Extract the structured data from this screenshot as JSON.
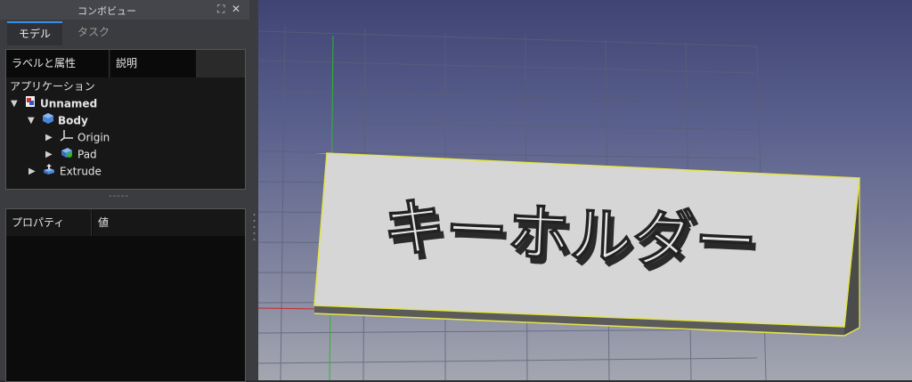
{
  "combo": {
    "title": "コンボビュー",
    "tabs": [
      "モデル",
      "タスク"
    ]
  },
  "tree": {
    "columns": [
      "ラベルと属性",
      "説明"
    ],
    "root_label": "アプリケーション",
    "items": [
      {
        "label": "Unnamed",
        "icon": "document-icon"
      },
      {
        "label": "Body",
        "icon": "body-icon"
      },
      {
        "label": "Origin",
        "icon": "origin-axes-icon"
      },
      {
        "label": "Pad",
        "icon": "pad-icon"
      },
      {
        "label": "Extrude",
        "icon": "extrude-icon"
      }
    ]
  },
  "properties": {
    "columns": [
      "プロパティ",
      "値"
    ]
  },
  "viewport": {
    "model_text": "キーホルダー"
  }
}
